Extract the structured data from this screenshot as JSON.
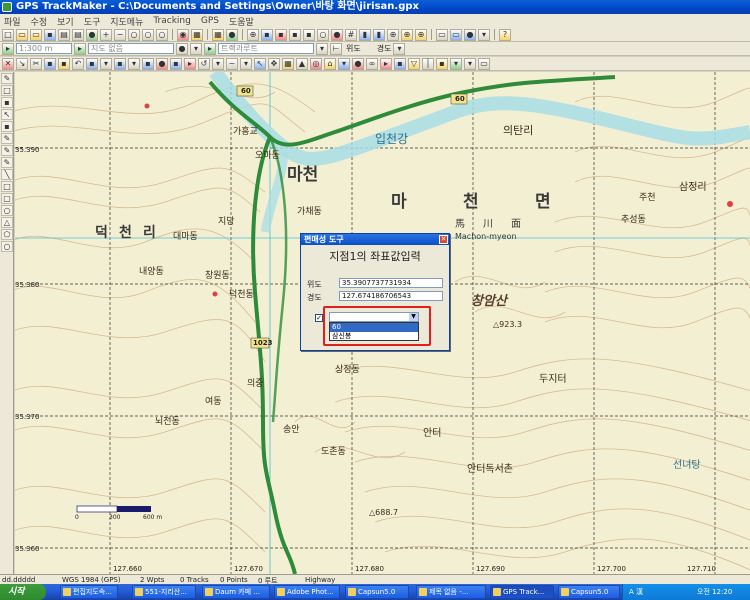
{
  "window": {
    "title": "GPS TrackMaker - C:\\Documents and Settings\\Owner\\바탕 화면\\jirisan.gpx"
  },
  "menu": [
    "파일",
    "수정",
    "보기",
    "도구",
    "지도메뉴",
    "Tracking",
    "GPS",
    "도움말"
  ],
  "toolbar2": {
    "scale": "1:300 m",
    "map_field": "지도 없음",
    "route_field": "트랙과루트"
  },
  "toolbar2_coords": {
    "lat_label": "위도",
    "lon_label": "경도"
  },
  "map": {
    "place_labels": [
      "마천",
      "마",
      "천",
      "면",
      "馬",
      "川",
      "面",
      "Machon-myeon",
      "창암산",
      "△923.3",
      "덕",
      "천",
      "리",
      "대마동",
      "가채동",
      "오마동",
      "의탄리",
      "입천강",
      "덕천동",
      "지당",
      "내양동",
      "창원동",
      "가흥교",
      "여동",
      "송안",
      "뇌전동",
      "도촌동",
      "안터",
      "안터독서촌",
      "두지터",
      "주천",
      "추성동",
      "삼정리",
      "선녀탕",
      "△688.7",
      "상정동",
      "의중"
    ],
    "road_labels": [
      "60",
      "60",
      "1023"
    ],
    "lat_ticks": [
      "35.390",
      "35.380",
      "35.370",
      "35.360"
    ],
    "lon_ticks": [
      "127.660",
      "127.670",
      "127.680",
      "127.690",
      "127.700",
      "127.710"
    ],
    "scalebar": {
      "zero": "0",
      "mid": "300",
      "end": "600 m"
    }
  },
  "dialog": {
    "title": "편매성 도구",
    "heading": "지점1의 좌표값입력",
    "lat_label": "위도",
    "lat_value": "35.3907737731934",
    "lon_label": "경도",
    "lon_value": "127.674186706543",
    "check_mark": "✓",
    "options": [
      "60",
      "삼신봉"
    ]
  },
  "statusbar": {
    "coord": "dd.ddddd",
    "datum": "WGS 1984 (GPS)",
    "wpts": "2 Wpts",
    "tracks": "0 Tracks",
    "points": "0 Points",
    "road": "0 루트",
    "highway": "Highway"
  },
  "taskbar": {
    "start": "시작",
    "tasks": [
      "편집지도속...",
      "551-지리산...",
      "Daum 카페 ...",
      "Adobe Phot...",
      "Capsun5.0",
      "제목 없음 -...",
      "GPS Track...",
      "Capsun5.0"
    ],
    "tray_lang": "A 漢",
    "clock": "오전 12:20"
  },
  "colors": {
    "title_bar": "#0a5fd8",
    "dialog_highlight": "#e02020",
    "route": "#2e8b3a",
    "river": "#a7dde6"
  }
}
